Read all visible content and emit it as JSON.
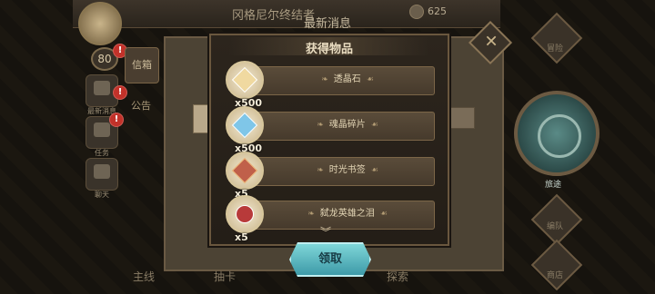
{
  "background": {
    "player_name": "冈格尼尔终结者",
    "level": "80",
    "resource_2": "625",
    "tabs": [
      "信箱",
      "公告"
    ],
    "left_icons": [
      "最新消息",
      "任务",
      "聊天"
    ],
    "right_labels": [
      "冒险",
      "旅途",
      "编队",
      "商店"
    ],
    "bottom_tabs": [
      "主线",
      "抽卡",
      "探索"
    ]
  },
  "modal": {
    "header": "最新消息",
    "title": "获得物品",
    "claim_label": "领取",
    "items": [
      {
        "name": "透晶石",
        "qty": "x500",
        "color": "#f0d9a0"
      },
      {
        "name": "魂晶碎片",
        "qty": "x500",
        "color": "#7fc6e8"
      },
      {
        "name": "时光书签",
        "qty": "x5",
        "color": "#c0604a"
      },
      {
        "name": "弑龙英雄之泪",
        "qty": "x5",
        "color": "#b83a3a"
      }
    ]
  }
}
